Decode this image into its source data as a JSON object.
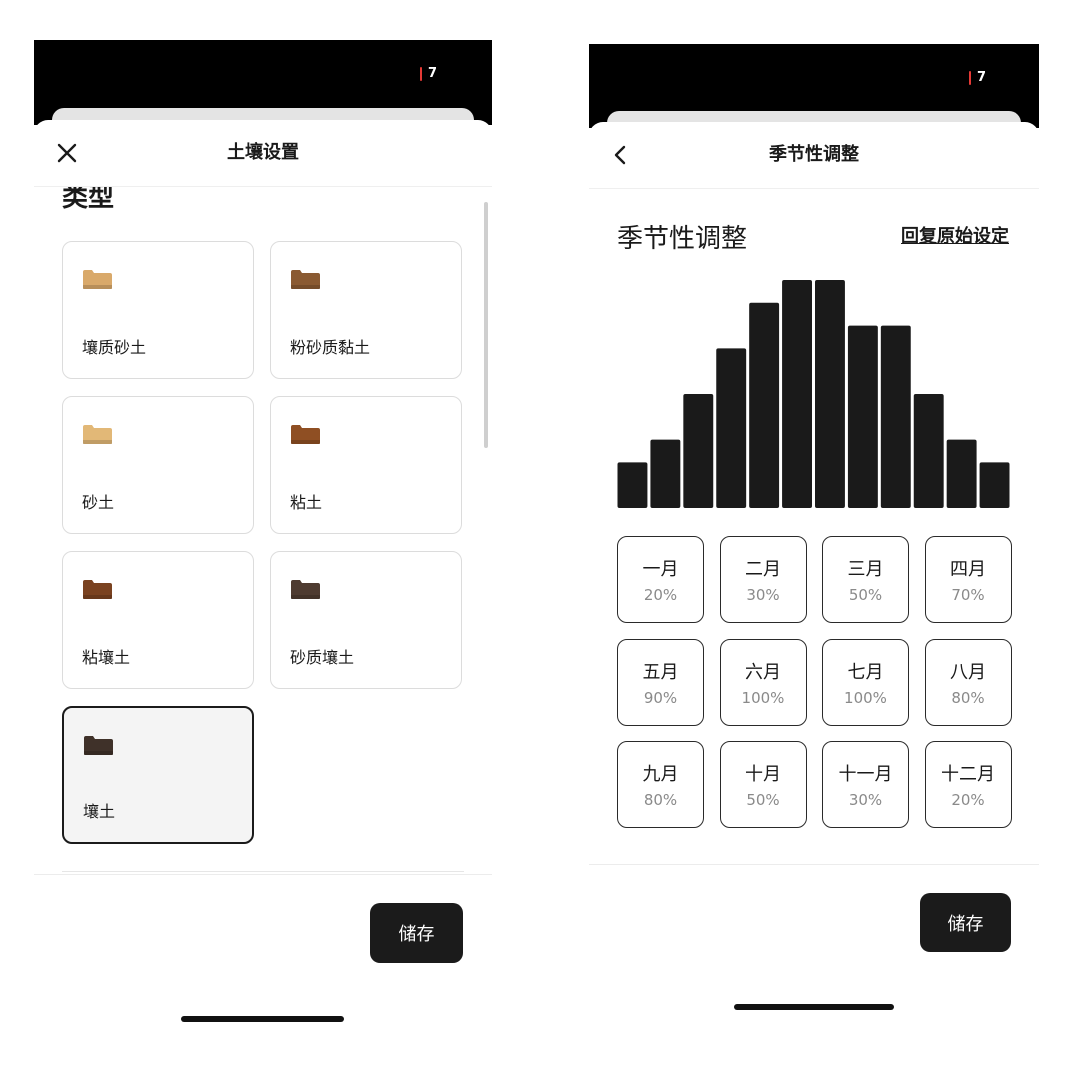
{
  "status_bar": {
    "battery_level": "7"
  },
  "soil_screen": {
    "title": "土壤设置",
    "close_icon": "close-icon",
    "section_heading": "类型",
    "soil_types": [
      {
        "label": "壤质砂土",
        "color": "#d9a96a",
        "selected": false
      },
      {
        "label": "粉砂质黏土",
        "color": "#8a5a32",
        "selected": false
      },
      {
        "label": "砂土",
        "color": "#e2b877",
        "selected": false
      },
      {
        "label": "粘土",
        "color": "#8f4f23",
        "selected": false
      },
      {
        "label": "粘壤土",
        "color": "#7a4220",
        "selected": false
      },
      {
        "label": "砂质壤土",
        "color": "#4e3b30",
        "selected": false
      },
      {
        "label": "壤土",
        "color": "#3f3129",
        "selected": true
      }
    ],
    "save_label": "储存"
  },
  "season_screen": {
    "title": "季节性调整",
    "back_icon": "chevron-left-icon",
    "heading": "季节性调整",
    "reset_label": "回复原始设定",
    "months": [
      {
        "name": "一月",
        "percent": "20%",
        "value": 20
      },
      {
        "name": "二月",
        "percent": "30%",
        "value": 30
      },
      {
        "name": "三月",
        "percent": "50%",
        "value": 50
      },
      {
        "name": "四月",
        "percent": "70%",
        "value": 70
      },
      {
        "name": "五月",
        "percent": "90%",
        "value": 90
      },
      {
        "name": "六月",
        "percent": "100%",
        "value": 100
      },
      {
        "name": "七月",
        "percent": "100%",
        "value": 100
      },
      {
        "name": "八月",
        "percent": "80%",
        "value": 80
      },
      {
        "name": "九月",
        "percent": "80%",
        "value": 80
      },
      {
        "name": "十月",
        "percent": "50%",
        "value": 50
      },
      {
        "name": "十一月",
        "percent": "30%",
        "value": 30
      },
      {
        "name": "十二月",
        "percent": "20%",
        "value": 20
      }
    ],
    "save_label": "储存"
  },
  "chart_data": {
    "type": "bar",
    "categories": [
      "一月",
      "二月",
      "三月",
      "四月",
      "五月",
      "六月",
      "七月",
      "八月",
      "九月",
      "十月",
      "十一月",
      "十二月"
    ],
    "values": [
      20,
      30,
      50,
      70,
      90,
      100,
      100,
      80,
      80,
      50,
      30,
      20
    ],
    "ylim": [
      0,
      100
    ],
    "bar_color": "#1a1a1a"
  }
}
